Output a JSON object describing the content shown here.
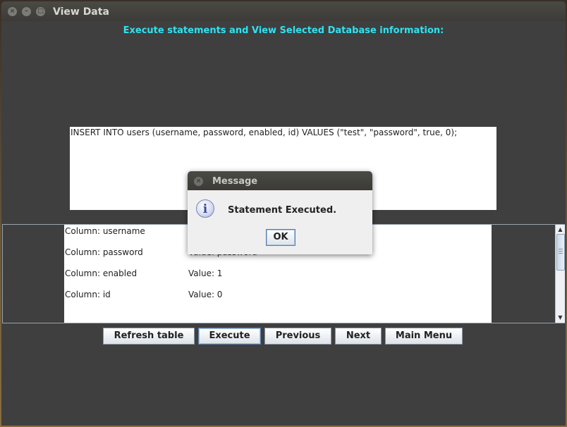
{
  "window": {
    "title": "View Data",
    "close_glyph": "×",
    "minimize_glyph": "–",
    "maximize_glyph": "□"
  },
  "header": {
    "label": "Execute statements and View Selected Database information:"
  },
  "sql_editor": {
    "value": "INSERT INTO users (username, password, enabled, id) VALUES (\"test\", \"password\", true, 0);"
  },
  "results": {
    "rows": [
      {
        "column": "Column: username",
        "value": ""
      },
      {
        "column": "Column: password",
        "value": "Value: password"
      },
      {
        "column": "Column: enabled",
        "value": "Value: 1"
      },
      {
        "column": "Column: id",
        "value": "Value: 0"
      }
    ]
  },
  "buttons": {
    "refresh": "Refresh table",
    "execute": "Execute",
    "previous": "Previous",
    "next": "Next",
    "main_menu": "Main Menu"
  },
  "dialog": {
    "title": "Message",
    "message": "Statement Executed.",
    "ok": "OK",
    "icon": "info-icon",
    "icon_glyph": "i"
  },
  "colors": {
    "header_text": "#2fe3f0",
    "window_bg": "#3f3f3f"
  }
}
